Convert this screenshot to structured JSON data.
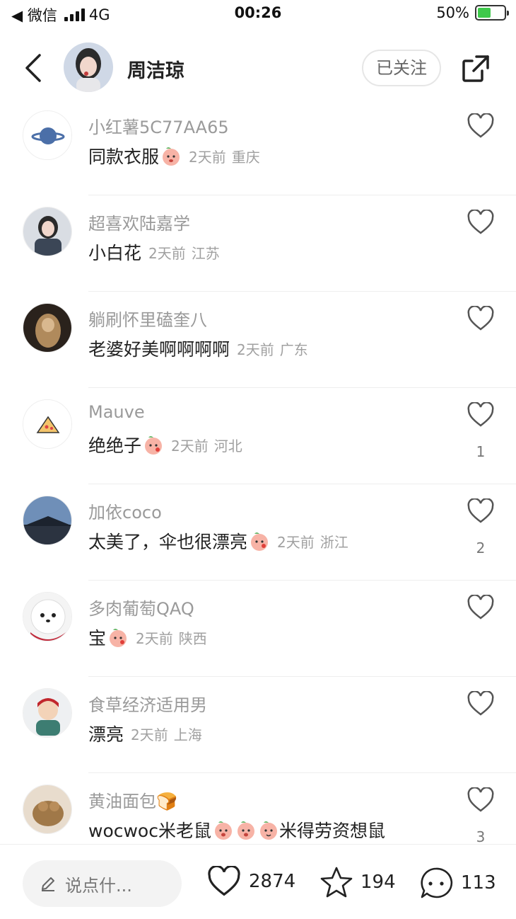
{
  "status_bar": {
    "carrier": "◀ 微信",
    "network": "4G",
    "time": "00:26",
    "battery": "50%"
  },
  "header": {
    "title": "周洁琼",
    "follow_label": "已关注"
  },
  "comments": [
    {
      "name": "小红薯5C77AA65",
      "text": "同款衣服",
      "emoji": "peach",
      "time": "2天前",
      "location": "重庆",
      "likes": ""
    },
    {
      "name": "超喜欢陆嘉学",
      "text": "小白花",
      "emoji": "",
      "time": "2天前",
      "location": "江苏",
      "likes": ""
    },
    {
      "name": "躺刷怀里磕奎八",
      "text": "老婆好美啊啊啊啊",
      "emoji": "",
      "time": "2天前",
      "location": "广东",
      "likes": ""
    },
    {
      "name": "Mauve",
      "text": "绝绝子",
      "emoji": "peach",
      "time": "2天前",
      "location": "河北",
      "likes": "1"
    },
    {
      "name": "加依coco",
      "text": "太美了，伞也很漂亮",
      "emoji": "peach",
      "time": "2天前",
      "location": "浙江",
      "likes": "2"
    },
    {
      "name": "多肉葡萄QAQ",
      "text": "宝",
      "emoji": "peach",
      "time": "2天前",
      "location": "陕西",
      "likes": ""
    },
    {
      "name": "食草经济适用男",
      "text": "漂亮",
      "emoji": "",
      "time": "2天前",
      "location": "上海",
      "likes": ""
    },
    {
      "name": "黄油面包🍞",
      "text": "wocwoc米老鼠",
      "text2": "米得劳资想鼠",
      "emoji": "peach3",
      "time": "",
      "location": "",
      "likes": "3"
    }
  ],
  "bottom_bar": {
    "input_placeholder": "说点什...",
    "likes": "2874",
    "stars": "194",
    "comments": "113"
  },
  "colors": {
    "battery": "#3ec94b",
    "muted_text": "#9a9a9a",
    "divider": "#eeeeee"
  }
}
